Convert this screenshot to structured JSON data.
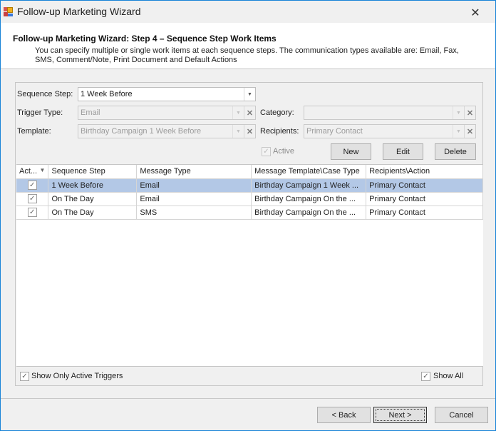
{
  "window": {
    "title": "Follow-up Marketing Wizard",
    "close_glyph": "✕"
  },
  "header": {
    "title": "Follow-up Marketing Wizard: Step 4 – Sequence Step Work Items",
    "description": "You can specify multiple or single work items at each sequence steps. The communication types available are: Email, Fax, SMS, Comment/Note, Print Document and Default Actions"
  },
  "form": {
    "sequence_step": {
      "label": "Sequence Step:",
      "value": "1 Week Before"
    },
    "trigger_type": {
      "label": "Trigger Type:",
      "value": "Email"
    },
    "template": {
      "label": "Template:",
      "value": "Birthday Campaign 1 Week Before"
    },
    "category": {
      "label": "Category:",
      "value": ""
    },
    "recipients": {
      "label": "Recipients:",
      "value": "Primary Contact"
    },
    "active": {
      "label": "Active",
      "checked": true
    },
    "arrow_glyph": "▼",
    "clear_glyph": "✕",
    "check_glyph": "✓"
  },
  "buttons": {
    "new": "New",
    "edit": "Edit",
    "delete": "Delete",
    "back": "< Back",
    "next": "Next >",
    "cancel": "Cancel"
  },
  "grid": {
    "columns": [
      "Act...",
      "Sequence Step",
      "Message Type",
      "Message Template\\Case Type",
      "Recipients\\Action"
    ],
    "filter_glyph": "▼",
    "rows": [
      {
        "active": true,
        "sequence_step": "1 Week Before",
        "message_type": "Email",
        "template": "Birthday Campaign 1 Week ...",
        "recipients": "Primary Contact",
        "selected": true
      },
      {
        "active": true,
        "sequence_step": "On The Day",
        "message_type": "Email",
        "template": "Birthday Campaign On the ...",
        "recipients": "Primary Contact",
        "selected": false
      },
      {
        "active": true,
        "sequence_step": "On The Day",
        "message_type": "SMS",
        "template": "Birthday Campaign On the ...",
        "recipients": "Primary Contact",
        "selected": false
      }
    ]
  },
  "options": {
    "show_only_active": {
      "label": "Show Only Active Triggers",
      "checked": true
    },
    "show_all": {
      "label": "Show All",
      "checked": true
    }
  }
}
